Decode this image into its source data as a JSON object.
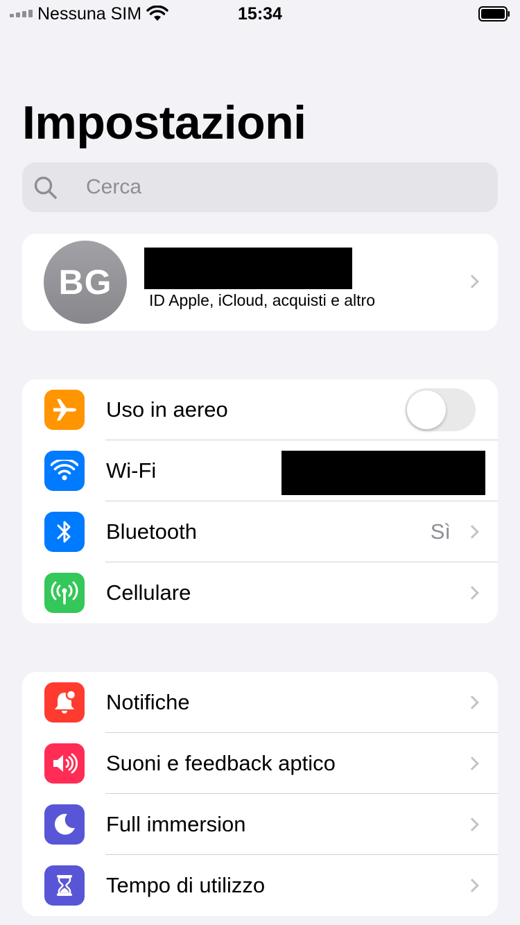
{
  "status_bar": {
    "carrier": "Nessuna SIM",
    "time": "15:34",
    "battery_icon": "battery-full-icon",
    "wifi_icon": "wifi-icon",
    "signal_icon": "cellular-signal-icon"
  },
  "title": "Impostazioni",
  "search": {
    "placeholder": "Cerca",
    "icon": "search-icon"
  },
  "profile": {
    "initials": "BG",
    "name": "[redacted]",
    "subtitle": "ID Apple, iCloud, acquisti e altro"
  },
  "network_group": [
    {
      "label": "Uso in aereo",
      "icon": "airplane-icon",
      "color": "#ff9500",
      "control": "toggle",
      "toggle_on": false
    },
    {
      "label": "Wi-Fi",
      "icon": "wifi-icon",
      "color": "#007aff",
      "value": "[redacted]"
    },
    {
      "label": "Bluetooth",
      "icon": "bluetooth-icon",
      "color": "#007aff",
      "value": "Sì"
    },
    {
      "label": "Cellulare",
      "icon": "cellular-antenna-icon",
      "color": "#34c759"
    }
  ],
  "notifications_group": [
    {
      "label": "Notifiche",
      "icon": "notification-bell-icon",
      "color": "#ff3b30"
    },
    {
      "label": "Suoni e feedback aptico",
      "icon": "speaker-icon",
      "color": "#ff2d55"
    },
    {
      "label": "Full immersion",
      "icon": "moon-icon",
      "color": "#5856d6"
    },
    {
      "label": "Tempo di utilizzo",
      "icon": "hourglass-icon",
      "color": "#5856d6"
    }
  ]
}
